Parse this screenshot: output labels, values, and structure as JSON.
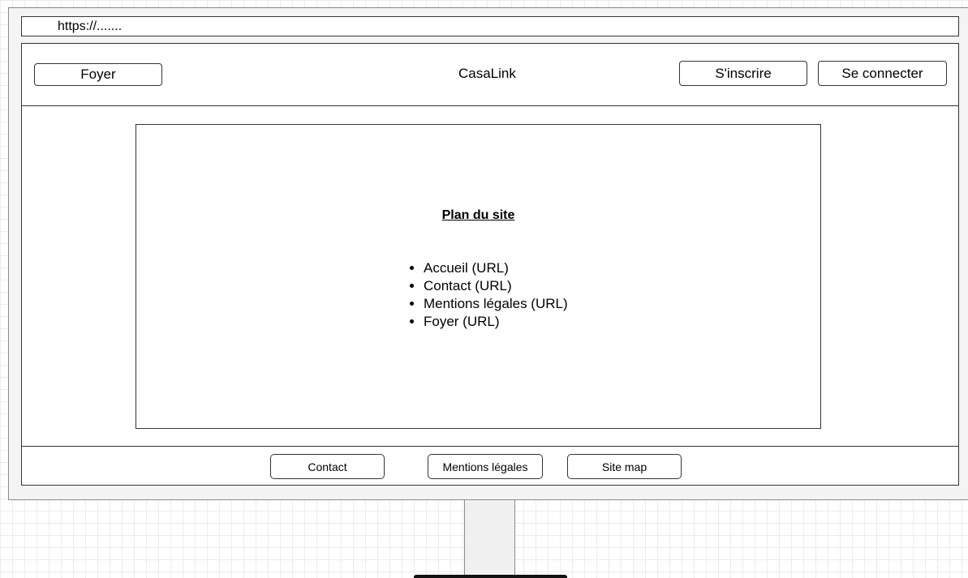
{
  "browser": {
    "url": "https://......."
  },
  "header": {
    "home_button": "Foyer",
    "brand": "CasaLink",
    "signup_button": "S'inscrire",
    "login_button": "Se connecter"
  },
  "main": {
    "title": "Plan du site",
    "items": [
      "Accueil (URL)",
      "Contact (URL)",
      "Mentions légales (URL)",
      "Foyer (URL)"
    ]
  },
  "footer": {
    "contact": "Contact",
    "legal": "Mentions légales",
    "sitemap": "Site map"
  }
}
